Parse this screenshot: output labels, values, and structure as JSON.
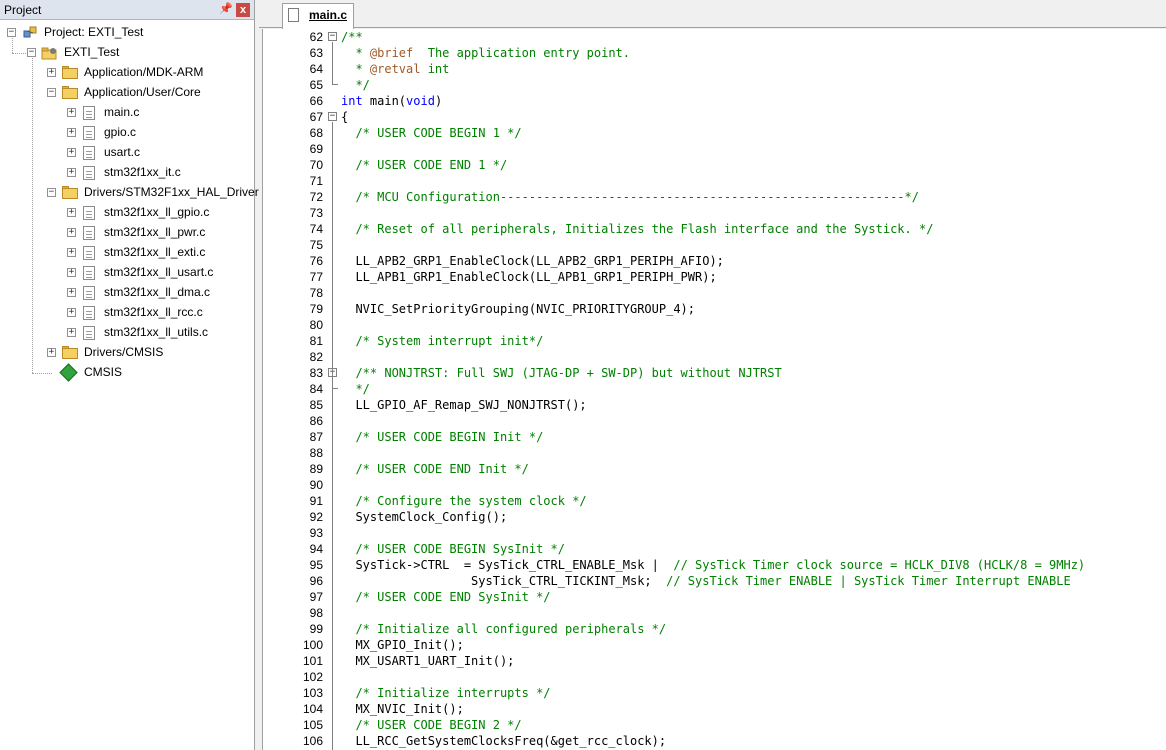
{
  "project_panel": {
    "title": "Project",
    "pin_icon": "pin-icon",
    "close_icon": "close-icon",
    "tree": {
      "root": "Project: EXTI_Test",
      "target": "EXTI_Test",
      "groups": [
        {
          "name": "Application/MDK-ARM",
          "expanded": false,
          "files": []
        },
        {
          "name": "Application/User/Core",
          "expanded": true,
          "files": [
            "main.c",
            "gpio.c",
            "usart.c",
            "stm32f1xx_it.c"
          ]
        },
        {
          "name": "Drivers/STM32F1xx_HAL_Driver",
          "expanded": true,
          "files": [
            "stm32f1xx_ll_gpio.c",
            "stm32f1xx_ll_pwr.c",
            "stm32f1xx_ll_exti.c",
            "stm32f1xx_ll_usart.c",
            "stm32f1xx_ll_dma.c",
            "stm32f1xx_ll_rcc.c",
            "stm32f1xx_ll_utils.c"
          ]
        },
        {
          "name": "Drivers/CMSIS",
          "expanded": false,
          "files": []
        }
      ],
      "cmsis": "CMSIS"
    }
  },
  "editor": {
    "tab_label": "main.c",
    "lines": [
      {
        "n": "62",
        "text": "/**",
        "fold": "open"
      },
      {
        "n": "63",
        "text": "  * @brief  The application entry point."
      },
      {
        "n": "64",
        "text": "  * @retval int"
      },
      {
        "n": "65",
        "text": "  */",
        "fold": "end"
      },
      {
        "n": "66",
        "text": "int main(void)"
      },
      {
        "n": "67",
        "text": "{",
        "fold": "open"
      },
      {
        "n": "68",
        "text": "  /* USER CODE BEGIN 1 */"
      },
      {
        "n": "69",
        "text": ""
      },
      {
        "n": "70",
        "text": "  /* USER CODE END 1 */"
      },
      {
        "n": "71",
        "text": ""
      },
      {
        "n": "72",
        "text": "  /* MCU Configuration--------------------------------------------------------*/"
      },
      {
        "n": "73",
        "text": ""
      },
      {
        "n": "74",
        "text": "  /* Reset of all peripherals, Initializes the Flash interface and the Systick. */"
      },
      {
        "n": "75",
        "text": ""
      },
      {
        "n": "76",
        "text": "  LL_APB2_GRP1_EnableClock(LL_APB2_GRP1_PERIPH_AFIO);"
      },
      {
        "n": "77",
        "text": "  LL_APB1_GRP1_EnableClock(LL_APB1_GRP1_PERIPH_PWR);"
      },
      {
        "n": "78",
        "text": ""
      },
      {
        "n": "79",
        "text": "  NVIC_SetPriorityGrouping(NVIC_PRIORITYGROUP_4);"
      },
      {
        "n": "80",
        "text": ""
      },
      {
        "n": "81",
        "text": "  /* System interrupt init*/"
      },
      {
        "n": "82",
        "text": ""
      },
      {
        "n": "83",
        "text": "  /** NONJTRST: Full SWJ (JTAG-DP + SW-DP) but without NJTRST",
        "fold": "open"
      },
      {
        "n": "84",
        "text": "  */",
        "fold": "end"
      },
      {
        "n": "85",
        "text": "  LL_GPIO_AF_Remap_SWJ_NONJTRST();"
      },
      {
        "n": "86",
        "text": ""
      },
      {
        "n": "87",
        "text": "  /* USER CODE BEGIN Init */"
      },
      {
        "n": "88",
        "text": ""
      },
      {
        "n": "89",
        "text": "  /* USER CODE END Init */"
      },
      {
        "n": "90",
        "text": ""
      },
      {
        "n": "91",
        "text": "  /* Configure the system clock */"
      },
      {
        "n": "92",
        "text": "  SystemClock_Config();"
      },
      {
        "n": "93",
        "text": ""
      },
      {
        "n": "94",
        "text": "  /* USER CODE BEGIN SysInit */"
      },
      {
        "n": "95",
        "text": "  SysTick->CTRL  = SysTick_CTRL_ENABLE_Msk |  // SysTick Timer clock source = HCLK_DIV8 (HCLK/8 = 9MHz)"
      },
      {
        "n": "96",
        "text": "                  SysTick_CTRL_TICKINT_Msk;  // SysTick Timer ENABLE | SysTick Timer Interrupt ENABLE"
      },
      {
        "n": "97",
        "text": "  /* USER CODE END SysInit */"
      },
      {
        "n": "98",
        "text": ""
      },
      {
        "n": "99",
        "text": "  /* Initialize all configured peripherals */"
      },
      {
        "n": "100",
        "text": "  MX_GPIO_Init();"
      },
      {
        "n": "101",
        "text": "  MX_USART1_UART_Init();"
      },
      {
        "n": "102",
        "text": ""
      },
      {
        "n": "103",
        "text": "  /* Initialize interrupts */"
      },
      {
        "n": "104",
        "text": "  MX_NVIC_Init();"
      },
      {
        "n": "105",
        "text": "  /* USER CODE BEGIN 2 */"
      },
      {
        "n": "106",
        "text": "  LL_RCC_GetSystemClocksFreq(&get_rcc_clock);"
      }
    ]
  },
  "colors": {
    "comment": "#008000",
    "keyword": "#0000ff",
    "doc_tag": "#a05a28",
    "panel_header": "#dde4ee",
    "close_button": "#c94a43"
  }
}
